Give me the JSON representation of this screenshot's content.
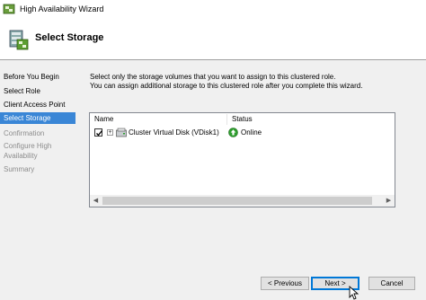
{
  "window": {
    "title": "High Availability Wizard",
    "icon": "cluster-wizard-icon"
  },
  "header": {
    "title": "Select Storage",
    "icon": "cluster-storage-icon"
  },
  "sidebar": {
    "items": [
      {
        "label": "Before You Begin",
        "state": "normal"
      },
      {
        "label": "Select Role",
        "state": "normal"
      },
      {
        "label": "Client Access Point",
        "state": "normal"
      },
      {
        "label": "Select Storage",
        "state": "active"
      },
      {
        "label": "Confirmation",
        "state": "disabled"
      },
      {
        "label": "Configure High Availability",
        "state": "disabled"
      },
      {
        "label": "Summary",
        "state": "disabled"
      }
    ]
  },
  "main": {
    "description_line1": "Select only the storage volumes that you want to assign to this clustered role.",
    "description_line2": "You can assign additional storage to this clustered role after you complete this wizard.",
    "table": {
      "columns": [
        "Name",
        "Status"
      ],
      "rows": [
        {
          "checked": true,
          "expand": "+",
          "name": "Cluster Virtual Disk (VDisk1)",
          "status": "Online",
          "status_color": "#2e9e2e"
        }
      ]
    }
  },
  "buttons": {
    "previous": "< Previous",
    "next": "Next >",
    "cancel": "Cancel"
  },
  "colors": {
    "accent": "#3a86d6",
    "button_focus": "#0078d7"
  }
}
